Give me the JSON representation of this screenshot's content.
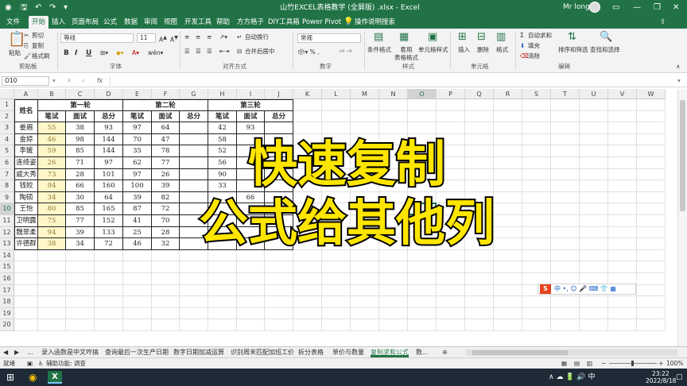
{
  "titlebar": {
    "title": "山竹EXCEL表格教学 (全屏版) .xlsx  -  Excel",
    "user": "Mr long",
    "save_icon": "save-icon",
    "minimize": "—",
    "restore": "❐",
    "close": "✕"
  },
  "menu": {
    "tabs": [
      "文件",
      "开始",
      "插入",
      "页面布局",
      "公式",
      "数据",
      "审阅",
      "视图",
      "开发工具",
      "帮助",
      "方方格子",
      "DIY工具箱",
      "Power Pivot",
      "操作说明搜索"
    ]
  },
  "ribbon": {
    "paste": "粘贴",
    "cut": "剪切",
    "copy": "复制",
    "format_painter": "格式刷",
    "clipboard_label": "剪贴板",
    "font_name": "等线",
    "font_size": "11",
    "bold": "B",
    "italic": "I",
    "underline": "U",
    "font_label": "字体",
    "wrap_text": "自动换行",
    "merge_center": "合并后居中",
    "alignment_label": "对齐方式",
    "number_format": "常规",
    "number_label": "数字",
    "conditional_format": "条件格式",
    "table_format": "套用\n表格格式",
    "cell_styles": "单元格样式",
    "styles_label": "样式",
    "insert": "插入",
    "delete": "删除",
    "format": "格式",
    "cells_label": "单元格",
    "autosum": "自动求和",
    "fill": "填充",
    "clear": "清除",
    "sort_filter": "排序和筛选",
    "find_select": "查找和选择",
    "editing_label": "编辑"
  },
  "formula_bar": {
    "name_box": "O10",
    "fx": "fx",
    "value": ""
  },
  "columns": [
    "A",
    "B",
    "C",
    "D",
    "E",
    "F",
    "G",
    "H",
    "I",
    "J",
    "K",
    "L",
    "M",
    "N",
    "O",
    "P",
    "Q",
    "R",
    "S",
    "T",
    "U",
    "V",
    "W"
  ],
  "rows": [
    "1",
    "2",
    "3",
    "4",
    "5",
    "6",
    "7",
    "8",
    "9",
    "10",
    "11",
    "12",
    "13",
    "14",
    "15",
    "16",
    "17",
    "18",
    "19",
    "20"
  ],
  "table": {
    "name_header": "姓名",
    "round1": "第一轮",
    "round2": "第二轮",
    "round3": "第三轮",
    "written": "笔试",
    "interview": "面试",
    "total": "总分",
    "names": [
      "姜眉",
      "金婷",
      "李媛",
      "连绮姿",
      "戚大秀",
      "钱姣",
      "陶硕",
      "王怡",
      "卫明露",
      "魏翠柔",
      "许德群"
    ],
    "r1": [
      [
        "55",
        "38",
        "93"
      ],
      [
        "46",
        "98",
        "144"
      ],
      [
        "59",
        "85",
        "144"
      ],
      [
        "26",
        "71",
        "97"
      ],
      [
        "73",
        "28",
        "101"
      ],
      [
        "94",
        "66",
        "160"
      ],
      [
        "34",
        "30",
        "64"
      ],
      [
        "80",
        "85",
        "165"
      ],
      [
        "75",
        "77",
        "152"
      ],
      [
        "94",
        "39",
        "133"
      ],
      [
        "38",
        "34",
        "72"
      ]
    ],
    "r2": [
      [
        "97",
        "64",
        ""
      ],
      [
        "70",
        "47",
        ""
      ],
      [
        "35",
        "78",
        ""
      ],
      [
        "62",
        "77",
        ""
      ],
      [
        "97",
        "26",
        ""
      ],
      [
        "100",
        "39",
        ""
      ],
      [
        "39",
        "82",
        ""
      ],
      [
        "87",
        "72",
        ""
      ],
      [
        "41",
        "70",
        ""
      ],
      [
        "25",
        "28",
        ""
      ],
      [
        "46",
        "32",
        ""
      ]
    ],
    "r3": [
      [
        "42",
        "93",
        ""
      ],
      [
        "58",
        "",
        ""
      ],
      [
        "52",
        "",
        ""
      ],
      [
        "56",
        "",
        ""
      ],
      [
        "90",
        "",
        ""
      ],
      [
        "33",
        "",
        ""
      ],
      [
        "",
        "66",
        ""
      ],
      [
        "",
        "",
        ""
      ],
      [
        "",
        "",
        ""
      ],
      [
        "",
        "",
        ""
      ],
      [
        "",
        "",
        ""
      ]
    ]
  },
  "overlay": {
    "line1": "快速复制",
    "line2": "公式给其他列"
  },
  "ime_bar": {
    "text": "中 •, ☺ 🎤 ⌨ 👕 ▦"
  },
  "sheets": {
    "nav": [
      "◀",
      "▶",
      "..."
    ],
    "tabs": [
      "录入函数是中文咋搞",
      "查询最后一次生产日期",
      "数字日期加减运算",
      "识别周末匹配加班工价",
      "拆分表格",
      "单价与数量",
      "复制求和公式",
      "数..."
    ],
    "active_index": 6,
    "add": "⊕"
  },
  "status": {
    "ready": "就绪",
    "accessibility": "辅助功能: 调查",
    "zoom": "100%"
  },
  "taskbar": {
    "time": "23:22",
    "date": "2022/8/18"
  }
}
